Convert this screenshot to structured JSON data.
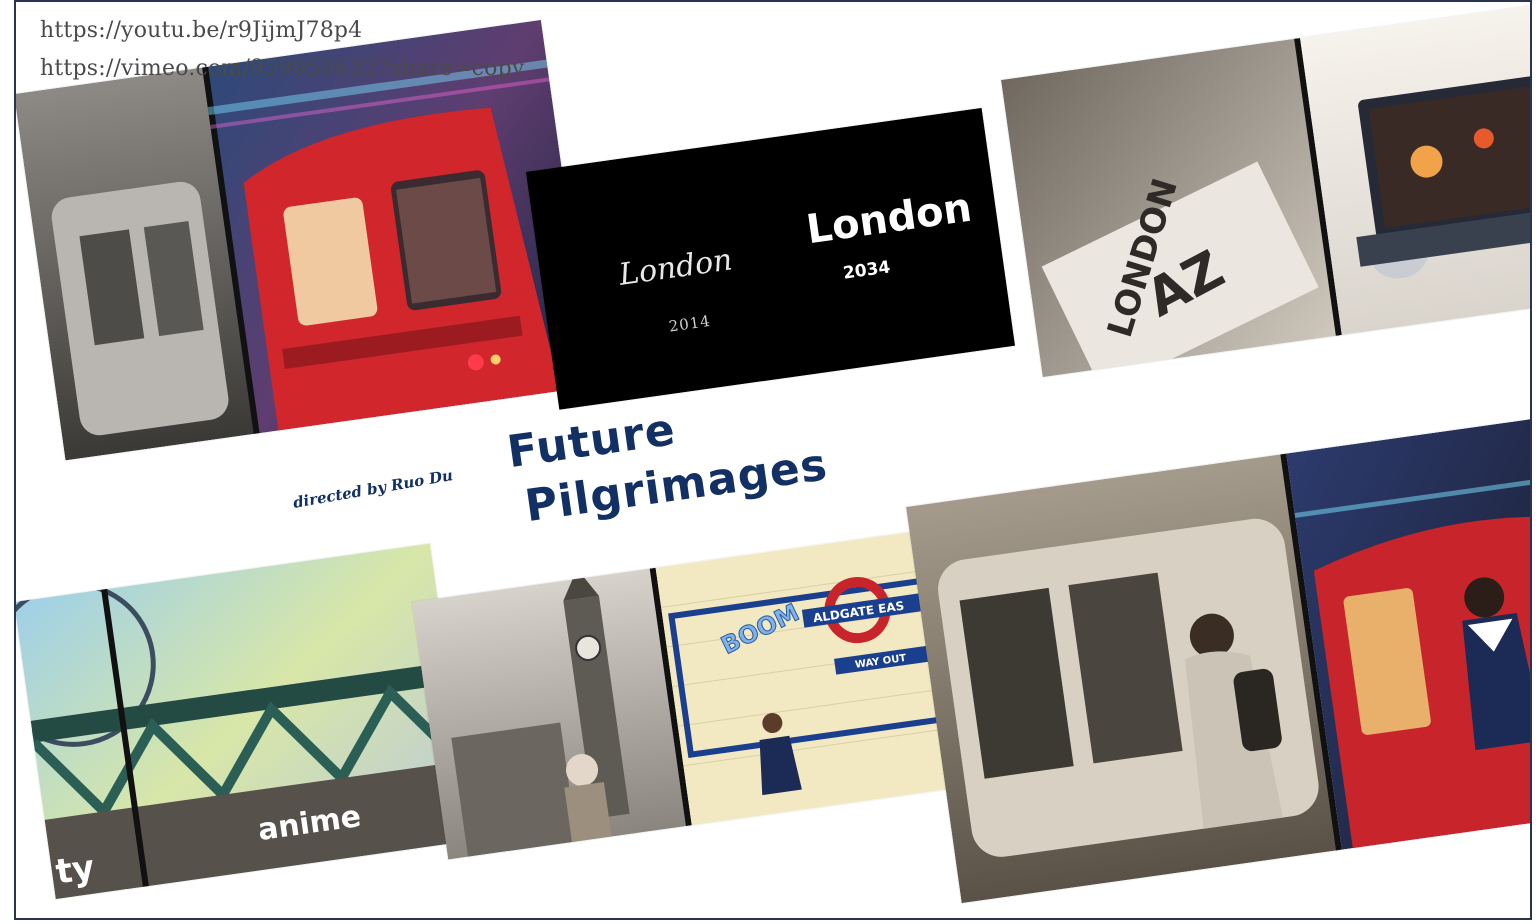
{
  "links": [
    "https://youtu.be/r9JijmJ78p4",
    "https://vimeo.com/959959632?share=copy"
  ],
  "title": {
    "line1": "Future",
    "line2": "Pilgrimages"
  },
  "credit": "directed by Ruo Du",
  "title_card": {
    "left_city": "London",
    "left_year": "2014",
    "right_city": "London",
    "right_year": "2034"
  },
  "captions": {
    "map_book": "LONDON",
    "map_book_mark": "AZ",
    "anime": "anime",
    "cut_word": "ty",
    "boom": "BOOM",
    "station": "ALDGATE EAS",
    "way_out": "WAY OUT"
  },
  "colors": {
    "title": "#123064",
    "frame": "#2a3550",
    "tube_red": "#c8242b",
    "roundel_blue": "#1b3f8f"
  }
}
